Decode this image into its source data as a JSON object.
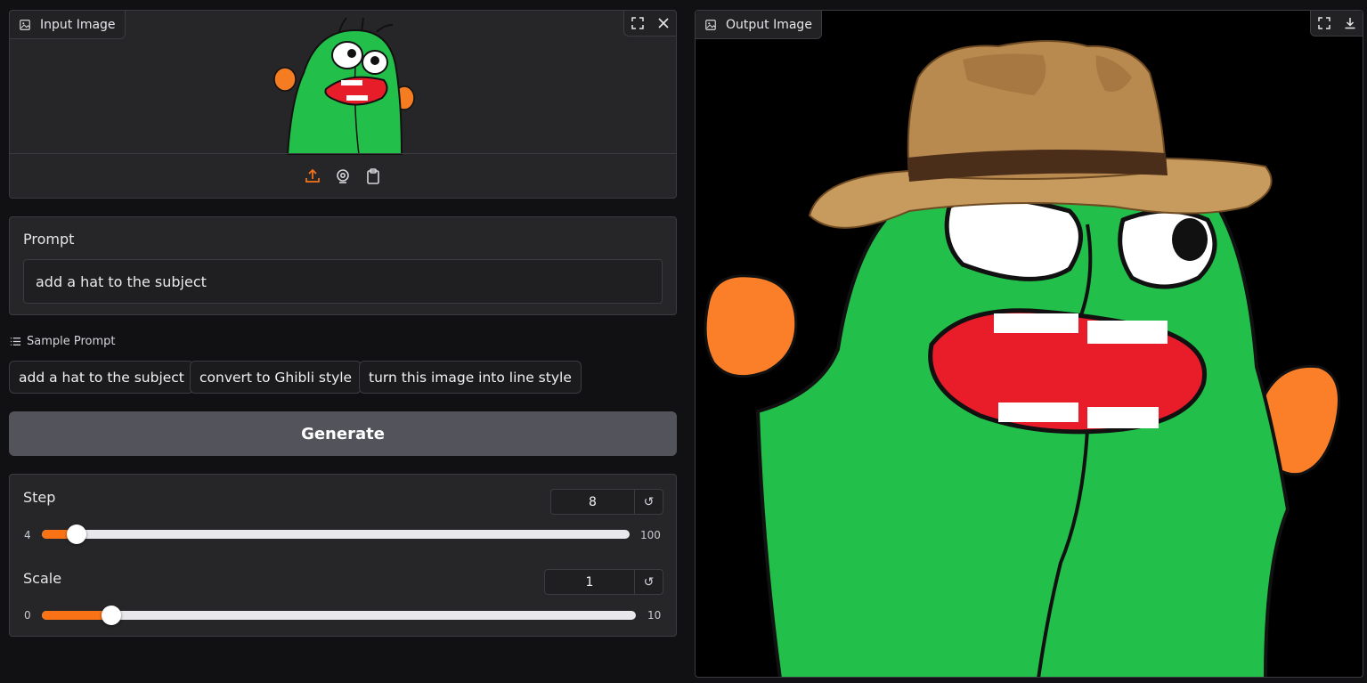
{
  "input_image": {
    "label": "Input Image",
    "icons": [
      "image-icon",
      "fullscreen-icon",
      "close-icon",
      "upload-icon",
      "webcam-icon",
      "clipboard-icon"
    ]
  },
  "prompt": {
    "label": "Prompt",
    "value": "add a hat to the subject"
  },
  "samples": {
    "label": "Sample Prompt",
    "items": [
      "add a hat to the subject",
      "convert to Ghibli style",
      "turn this image into line style"
    ]
  },
  "generate_label": "Generate",
  "step": {
    "label": "Step",
    "value": "8",
    "min": "4",
    "max": "100",
    "fraction": 0.042
  },
  "scale": {
    "label": "Scale",
    "value": "1",
    "min": "0",
    "max": "10",
    "fraction": 0.1
  },
  "output_image": {
    "label": "Output Image",
    "icons": [
      "image-icon",
      "fullscreen-icon",
      "download-icon"
    ]
  },
  "colors": {
    "accent": "#f97316",
    "cactus_green": "#22c04a",
    "hat_brown": "#c49a5e"
  }
}
